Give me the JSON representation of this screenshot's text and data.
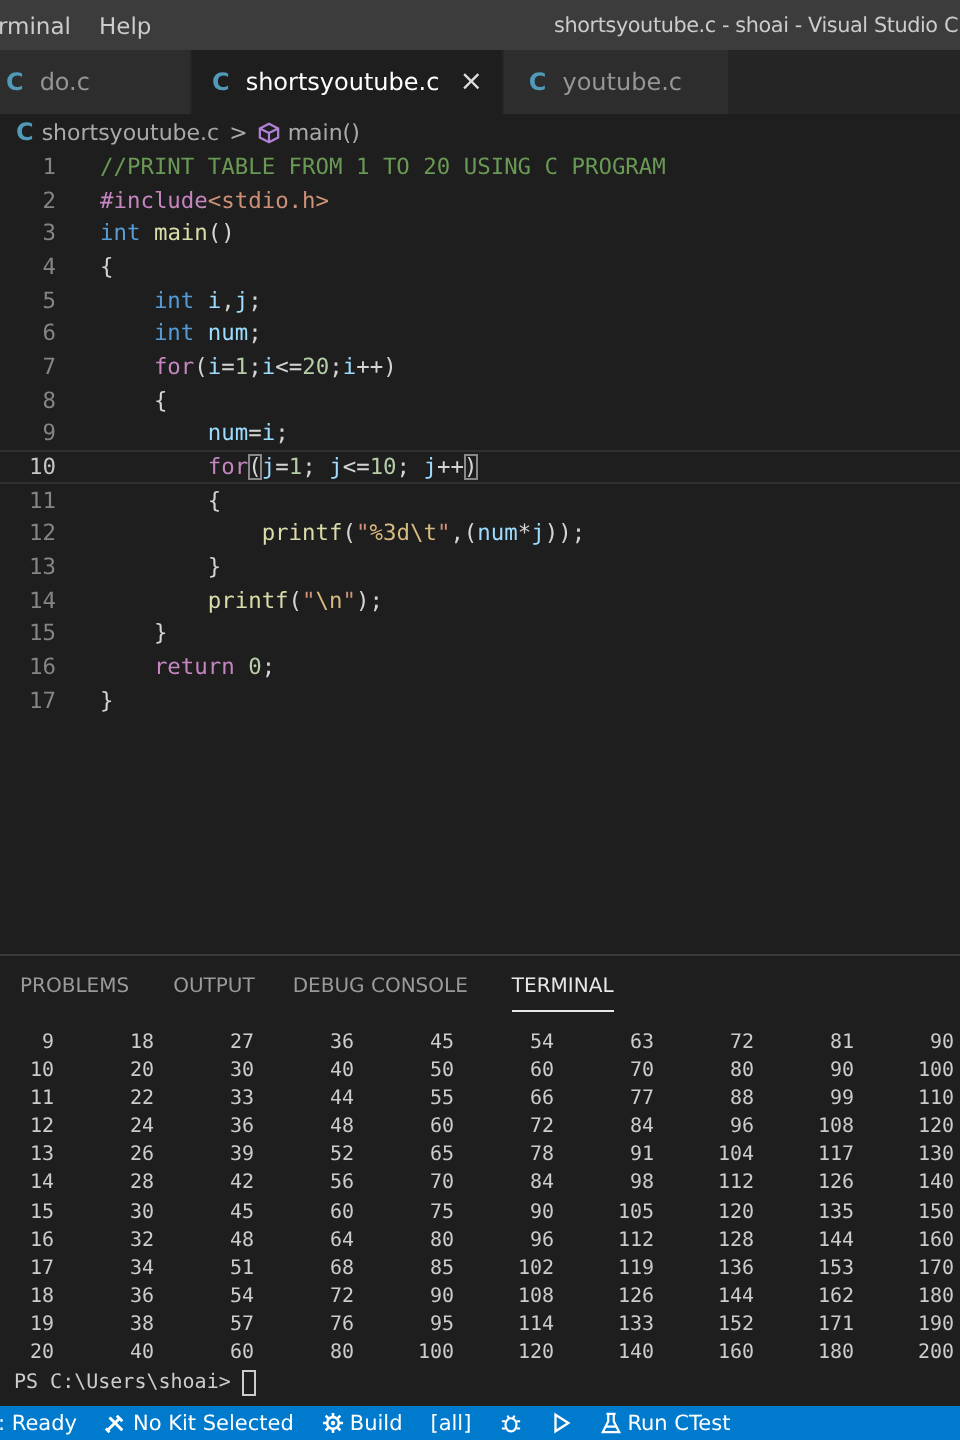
{
  "title_bar": {
    "menu": [
      "rminal",
      "Help"
    ],
    "title": "shortsyoutube.c - shoai - Visual Studio C"
  },
  "tabs": [
    {
      "glyph": "C",
      "label": "do.c",
      "selected": false
    },
    {
      "glyph": "C",
      "label": "shortsyoutube.c",
      "selected": true,
      "close": "×"
    },
    {
      "glyph": "C",
      "label": "youtube.c",
      "selected": false
    }
  ],
  "breadcrumb": {
    "glyph": "C",
    "file": "shortsyoutube.c",
    "separator": ">",
    "symbol": "main()"
  },
  "code": [
    {
      "number": "1",
      "current": false,
      "tokens": [
        {
          "kind": "comment",
          "text": "//PRINT TABLE FROM 1 TO 20 USING C PROGRAM"
        }
      ]
    },
    {
      "number": "2",
      "current": false,
      "tokens": [
        {
          "kind": "control",
          "text": "#include"
        },
        {
          "kind": "string",
          "text": "<stdio.h>"
        }
      ]
    },
    {
      "number": "3",
      "current": false,
      "tokens": [
        {
          "kind": "type",
          "text": "int "
        },
        {
          "kind": "func",
          "text": "main"
        },
        {
          "kind": "plain",
          "text": "()"
        }
      ]
    },
    {
      "number": "4",
      "current": false,
      "tokens": [
        {
          "kind": "plain",
          "text": "{"
        }
      ]
    },
    {
      "number": "5",
      "current": false,
      "tokens": [
        {
          "kind": "type",
          "text": "    int "
        },
        {
          "kind": "var",
          "text": "i"
        },
        {
          "kind": "plain",
          "text": ","
        },
        {
          "kind": "var",
          "text": "j"
        },
        {
          "kind": "plain",
          "text": ";"
        }
      ]
    },
    {
      "number": "6",
      "current": false,
      "tokens": [
        {
          "kind": "type",
          "text": "    int "
        },
        {
          "kind": "var",
          "text": "num"
        },
        {
          "kind": "plain",
          "text": ";"
        }
      ]
    },
    {
      "number": "7",
      "current": false,
      "tokens": [
        {
          "kind": "control",
          "text": "    for"
        },
        {
          "kind": "plain",
          "text": "("
        },
        {
          "kind": "var",
          "text": "i"
        },
        {
          "kind": "plain",
          "text": "="
        },
        {
          "kind": "num",
          "text": "1"
        },
        {
          "kind": "plain",
          "text": ";"
        },
        {
          "kind": "var",
          "text": "i"
        },
        {
          "kind": "plain",
          "text": "<="
        },
        {
          "kind": "num",
          "text": "20"
        },
        {
          "kind": "plain",
          "text": ";"
        },
        {
          "kind": "var",
          "text": "i"
        },
        {
          "kind": "plain",
          "text": "++)"
        }
      ]
    },
    {
      "number": "8",
      "current": false,
      "tokens": [
        {
          "kind": "plain",
          "text": "    {"
        }
      ]
    },
    {
      "number": "9",
      "current": false,
      "tokens": [
        {
          "kind": "var",
          "text": "        num"
        },
        {
          "kind": "plain",
          "text": "="
        },
        {
          "kind": "var",
          "text": "i"
        },
        {
          "kind": "plain",
          "text": ";"
        }
      ]
    },
    {
      "number": "10",
      "current": true,
      "tokens": [
        {
          "kind": "control",
          "text": "        for"
        },
        {
          "kind": "match",
          "text": "("
        },
        {
          "kind": "var",
          "text": "j"
        },
        {
          "kind": "plain",
          "text": "="
        },
        {
          "kind": "num",
          "text": "1"
        },
        {
          "kind": "plain",
          "text": "; "
        },
        {
          "kind": "var",
          "text": "j"
        },
        {
          "kind": "plain",
          "text": "<="
        },
        {
          "kind": "num",
          "text": "10"
        },
        {
          "kind": "plain",
          "text": "; "
        },
        {
          "kind": "var",
          "text": "j"
        },
        {
          "kind": "plain",
          "text": "++"
        },
        {
          "kind": "match",
          "text": ")"
        }
      ]
    },
    {
      "number": "11",
      "current": false,
      "tokens": [
        {
          "kind": "plain",
          "text": "        {"
        }
      ]
    },
    {
      "number": "12",
      "current": false,
      "tokens": [
        {
          "kind": "func",
          "text": "            printf"
        },
        {
          "kind": "plain",
          "text": "("
        },
        {
          "kind": "string",
          "text": "\""
        },
        {
          "kind": "escape",
          "text": "%3d\\t"
        },
        {
          "kind": "string",
          "text": "\""
        },
        {
          "kind": "plain",
          "text": ",("
        },
        {
          "kind": "var",
          "text": "num"
        },
        {
          "kind": "plain",
          "text": "*"
        },
        {
          "kind": "var",
          "text": "j"
        },
        {
          "kind": "plain",
          "text": "));"
        }
      ]
    },
    {
      "number": "13",
      "current": false,
      "tokens": [
        {
          "kind": "plain",
          "text": "        }"
        }
      ]
    },
    {
      "number": "14",
      "current": false,
      "tokens": [
        {
          "kind": "func",
          "text": "        printf"
        },
        {
          "kind": "plain",
          "text": "("
        },
        {
          "kind": "string",
          "text": "\""
        },
        {
          "kind": "escape",
          "text": "\\n"
        },
        {
          "kind": "string",
          "text": "\""
        },
        {
          "kind": "plain",
          "text": ");"
        }
      ]
    },
    {
      "number": "15",
      "current": false,
      "tokens": [
        {
          "kind": "plain",
          "text": "    }"
        }
      ]
    },
    {
      "number": "16",
      "current": false,
      "tokens": [
        {
          "kind": "control",
          "text": "    return "
        },
        {
          "kind": "num",
          "text": "0"
        },
        {
          "kind": "plain",
          "text": ";"
        }
      ]
    },
    {
      "number": "17",
      "current": false,
      "tokens": [
        {
          "kind": "plain",
          "text": "}"
        }
      ]
    }
  ],
  "panel_tabs": [
    {
      "label": "PROBLEMS",
      "selected": false
    },
    {
      "label": "OUTPUT",
      "selected": false
    },
    {
      "label": "DEBUG CONSOLE",
      "selected": false
    },
    {
      "label": "TERMINAL",
      "selected": true
    }
  ],
  "terminal": {
    "rows": [
      [
        "9",
        "18",
        "27",
        "36",
        "45",
        "54",
        "63",
        "72",
        "81",
        "90"
      ],
      [
        "10",
        "20",
        "30",
        "40",
        "50",
        "60",
        "70",
        "80",
        "90",
        "100"
      ],
      [
        "11",
        "22",
        "33",
        "44",
        "55",
        "66",
        "77",
        "88",
        "99",
        "110"
      ],
      [
        "12",
        "24",
        "36",
        "48",
        "60",
        "72",
        "84",
        "96",
        "108",
        "120"
      ],
      [
        "13",
        "26",
        "39",
        "52",
        "65",
        "78",
        "91",
        "104",
        "117",
        "130"
      ],
      [
        "14",
        "28",
        "42",
        "56",
        "70",
        "84",
        "98",
        "112",
        "126",
        "140"
      ],
      [
        "15",
        "30",
        "45",
        "60",
        "75",
        "90",
        "105",
        "120",
        "135",
        "150"
      ],
      [
        "16",
        "32",
        "48",
        "64",
        "80",
        "96",
        "112",
        "128",
        "144",
        "160"
      ],
      [
        "17",
        "34",
        "51",
        "68",
        "85",
        "102",
        "119",
        "136",
        "153",
        "170"
      ],
      [
        "18",
        "36",
        "54",
        "72",
        "90",
        "108",
        "126",
        "144",
        "162",
        "180"
      ],
      [
        "19",
        "38",
        "57",
        "76",
        "95",
        "114",
        "133",
        "152",
        "171",
        "190"
      ],
      [
        "20",
        "40",
        "60",
        "80",
        "100",
        "120",
        "140",
        "160",
        "180",
        "200"
      ]
    ],
    "prompt": "PS C:\\Users\\shoai>"
  },
  "status_bar": [
    {
      "kind": "text",
      "label": ": Ready"
    },
    {
      "kind": "tools",
      "label": "No Kit Selected"
    },
    {
      "kind": "gear",
      "label": "Build"
    },
    {
      "kind": "text",
      "label": "[all]"
    },
    {
      "kind": "bug"
    },
    {
      "kind": "play"
    },
    {
      "kind": "flask",
      "label": "Run CTest"
    }
  ]
}
